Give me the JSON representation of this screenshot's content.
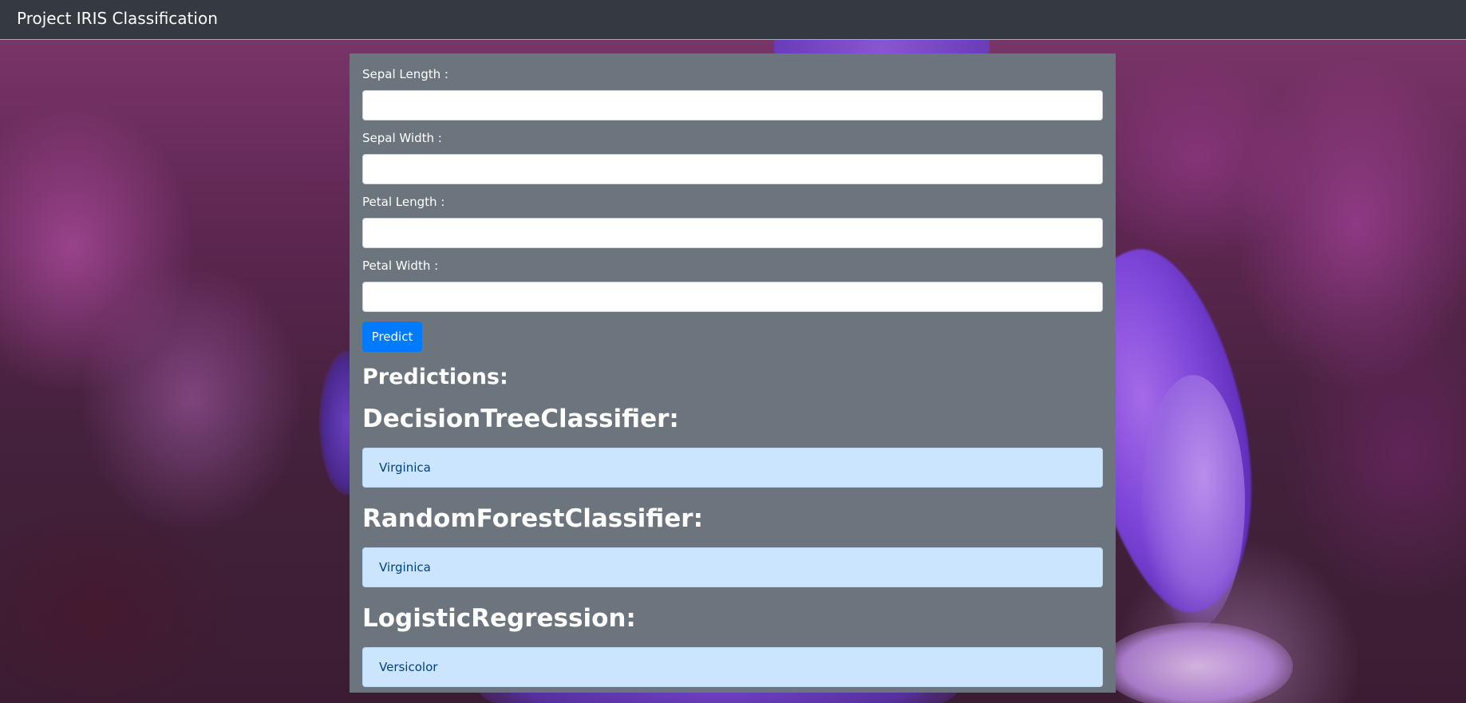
{
  "navbar": {
    "brand": "Project IRIS Classification"
  },
  "form": {
    "fields": [
      {
        "label": "Sepal Length :",
        "value": ""
      },
      {
        "label": "Sepal Width :",
        "value": ""
      },
      {
        "label": "Petal Length :",
        "value": ""
      },
      {
        "label": "Petal Width :",
        "value": ""
      }
    ],
    "submit_label": "Predict"
  },
  "predictions": {
    "heading": "Predictions:",
    "models": [
      {
        "name": "DecisionTreeClassifier:",
        "result": "Virginica"
      },
      {
        "name": "RandomForestClassifier:",
        "result": "Virginica"
      },
      {
        "name": "LogisticRegression:",
        "result": "Versicolor"
      }
    ]
  },
  "colors": {
    "navbar": "#343a40",
    "card": "#6c757d",
    "primary_button": "#007bff",
    "result_bg": "#cce5ff",
    "result_text": "#004085"
  }
}
